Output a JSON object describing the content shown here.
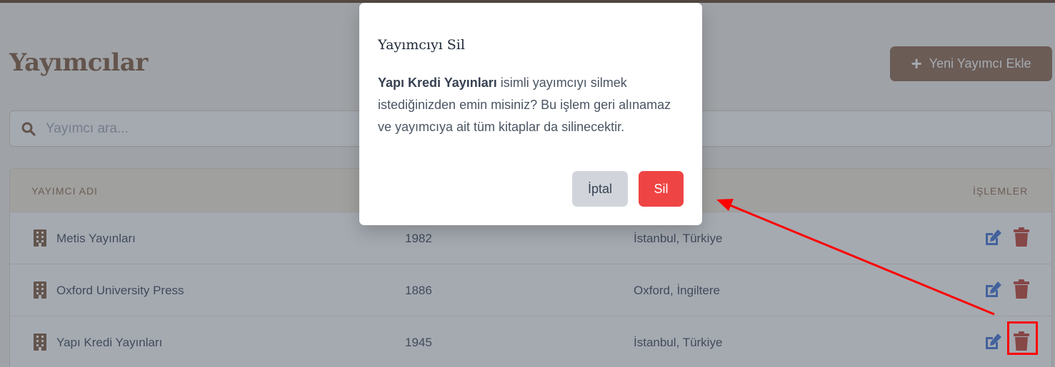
{
  "header": {
    "title": "Yayımcılar",
    "add_button_label": "Yeni Yayımcı Ekle"
  },
  "search": {
    "placeholder": "Yayımcı ara..."
  },
  "table": {
    "columns": [
      "YAYIMCI ADI",
      "",
      "",
      "İŞLEMLER"
    ],
    "rows": [
      {
        "name": "Metis Yayınları",
        "year": "1982",
        "location": "İstanbul, Türkiye"
      },
      {
        "name": "Oxford University Press",
        "year": "1886",
        "location": "Oxford, İngiltere"
      },
      {
        "name": "Yapı Kredi Yayınları",
        "year": "1945",
        "location": "İstanbul, Türkiye"
      }
    ]
  },
  "modal": {
    "title": "Yayımcıyı Sil",
    "publisher_name": "Yapı Kredi Yayınları",
    "message": " isimli yayımcıyı silmek istediğinizden emin misiniz? Bu işlem geri alınamaz ve yayımcıya ait tüm kitaplar da silinecektir.",
    "cancel_label": "İptal",
    "delete_label": "Sil"
  },
  "colors": {
    "brand": "#8b6348",
    "danger": "#ef4444",
    "edit_icon": "#3b6fd4",
    "delete_icon": "#c0392b",
    "annotation": "#ff0000"
  },
  "icons": {
    "search": "search-icon",
    "add": "plus-icon",
    "row": "building-icon",
    "edit": "edit-icon",
    "delete": "trash-icon"
  }
}
